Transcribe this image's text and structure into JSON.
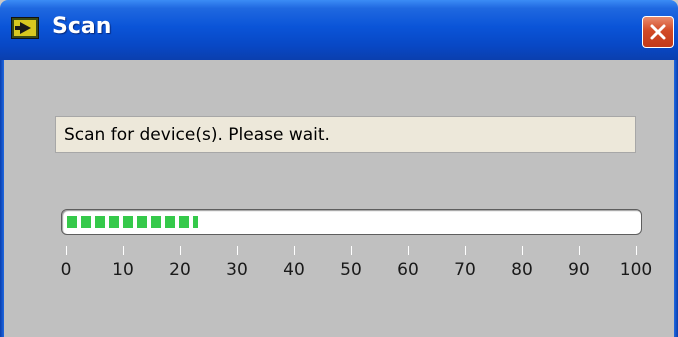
{
  "window": {
    "title": "Scan",
    "close_glyph": "✕"
  },
  "status": {
    "text": "Scan for device(s). Please wait."
  },
  "progress": {
    "value_percent": 23,
    "color": "#35c94a"
  },
  "scale": {
    "ticks": [
      "0",
      "10",
      "20",
      "30",
      "40",
      "50",
      "60",
      "70",
      "80",
      "90",
      "100"
    ],
    "min": 0,
    "max": 100
  },
  "icons": {
    "app": "labview-vi-icon",
    "close": "close-icon"
  }
}
